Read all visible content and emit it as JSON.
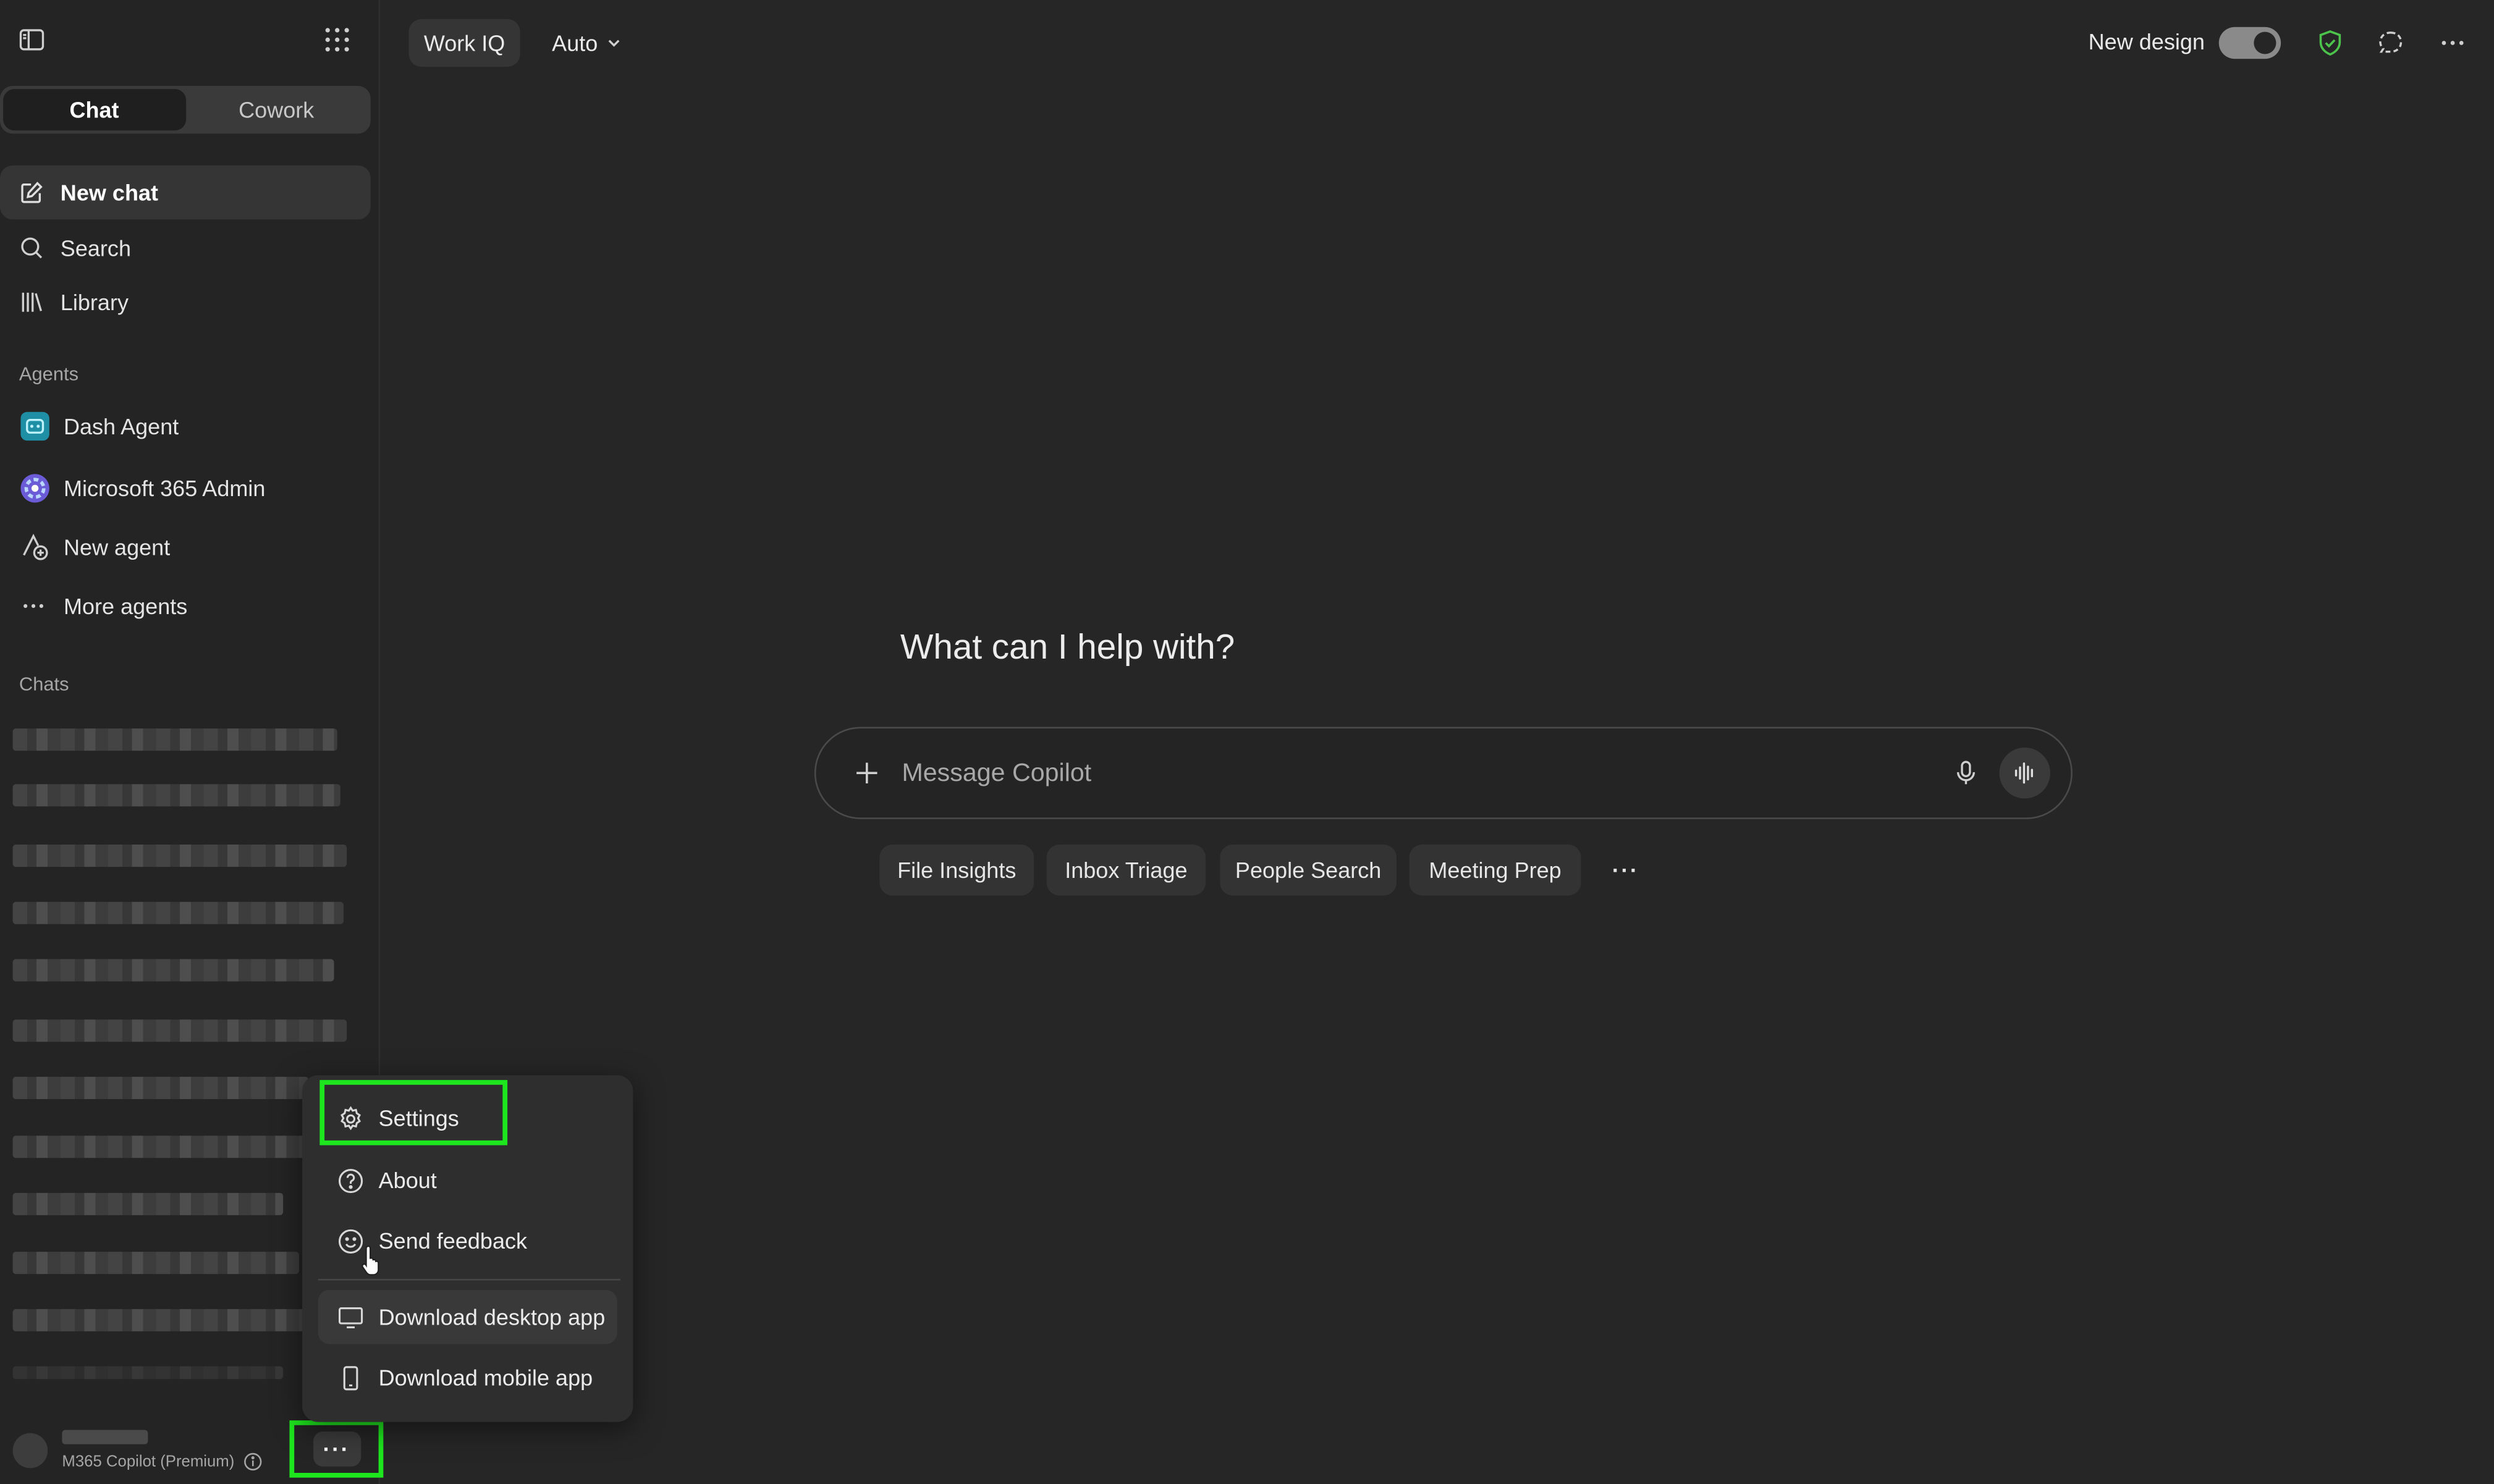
{
  "top_bar": {
    "work_iq_label": "Work IQ",
    "mode_label": "Auto",
    "new_design_label": "New design",
    "new_design_on": true
  },
  "sidebar": {
    "tabs": [
      "Chat",
      "Cowork"
    ],
    "active_tab": "Chat",
    "nav": {
      "new_chat": "New chat",
      "search": "Search",
      "library": "Library"
    },
    "agents_label": "Agents",
    "agents": {
      "dash": "Dash Agent",
      "admin": "Microsoft 365 Admin",
      "new_agent": "New agent",
      "more_agents": "More agents"
    },
    "chats_label": "Chats",
    "profile": {
      "plan": "M365 Copilot (Premium)"
    },
    "more_label": "···"
  },
  "menu": {
    "settings": "Settings",
    "about": "About",
    "send_feedback": "Send feedback",
    "download_desktop": "Download desktop app",
    "download_mobile": "Download mobile app"
  },
  "main": {
    "hero": "What can I help with?",
    "composer_placeholder": "Message Copilot",
    "chips": {
      "file_insights": "File Insights",
      "inbox_triage": "Inbox Triage",
      "people_search": "People Search",
      "meeting_prep": "Meeting Prep"
    },
    "chips_more": "···"
  },
  "colors": {
    "background": "#262626",
    "sidebar": "#242424",
    "highlight": "#1ee61e",
    "shield": "#4cc44c"
  }
}
